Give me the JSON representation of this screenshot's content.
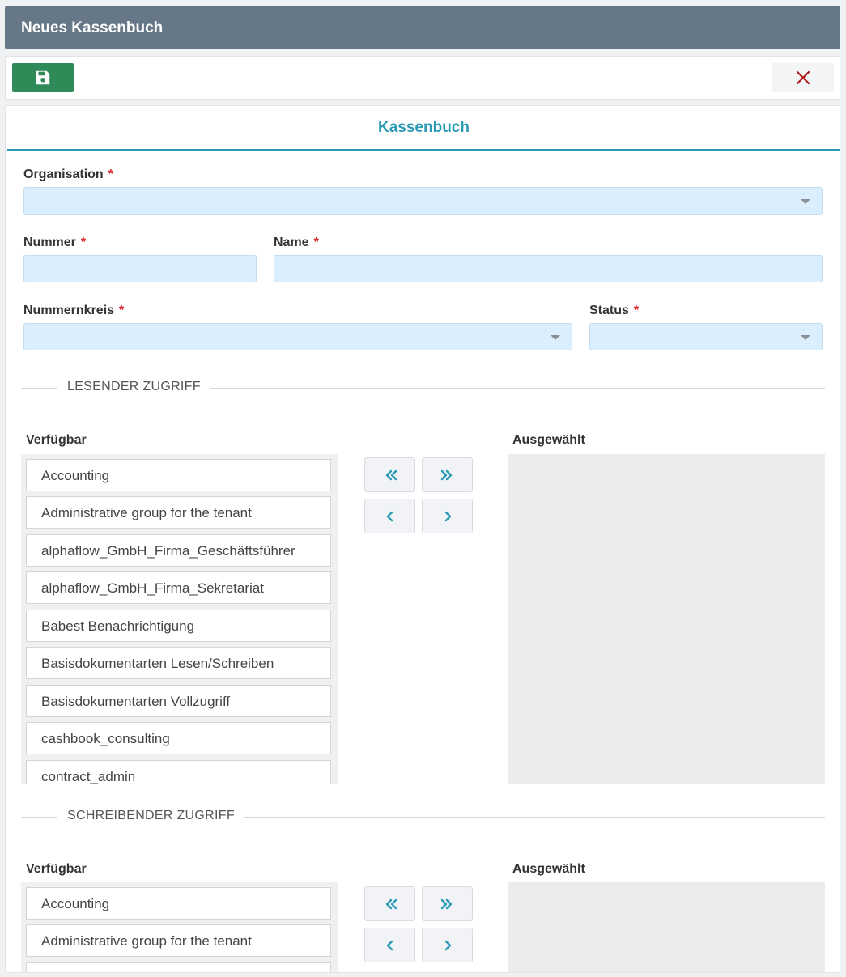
{
  "window": {
    "title": "Neues Kassenbuch"
  },
  "toolbar": {
    "save_icon": "save-icon",
    "close_icon": "close-icon",
    "save_color": "#2e8b57",
    "close_color": "#b0161a"
  },
  "tab": {
    "label": "Kassenbuch"
  },
  "form": {
    "organisation": {
      "label": "Organisation",
      "required": "*",
      "value": ""
    },
    "nummer": {
      "label": "Nummer",
      "required": "*",
      "value": ""
    },
    "name": {
      "label": "Name",
      "required": "*",
      "value": ""
    },
    "nummernkreis": {
      "label": "Nummernkreis",
      "required": "*",
      "value": ""
    },
    "status": {
      "label": "Status",
      "required": "*",
      "value": ""
    }
  },
  "read_access": {
    "title": "LESENDER ZUGRIFF",
    "available_label": "Verfügbar",
    "selected_label": "Ausgewählt",
    "available": [
      "Accounting",
      "Administrative group for the tenant",
      "alphaflow_GmbH_Firma_Geschäftsführer",
      "alphaflow_GmbH_Firma_Sekretariat",
      "Babest Benachrichtigung",
      "Basisdokumentarten Lesen/Schreiben",
      "Basisdokumentarten Vollzugriff",
      "cashbook_consulting",
      "contract_admin"
    ],
    "selected": []
  },
  "write_access": {
    "title": "SCHREIBENDER ZUGRIFF",
    "available_label": "Verfügbar",
    "selected_label": "Ausgewählt",
    "available": [
      "Accounting",
      "Administrative group for the tenant",
      ""
    ],
    "selected": []
  },
  "transfer_buttons": [
    "move-all-right-icon",
    "move-all-left-icon",
    "move-left-icon",
    "move-right-icon"
  ],
  "accent_color": "#2b9ab5"
}
